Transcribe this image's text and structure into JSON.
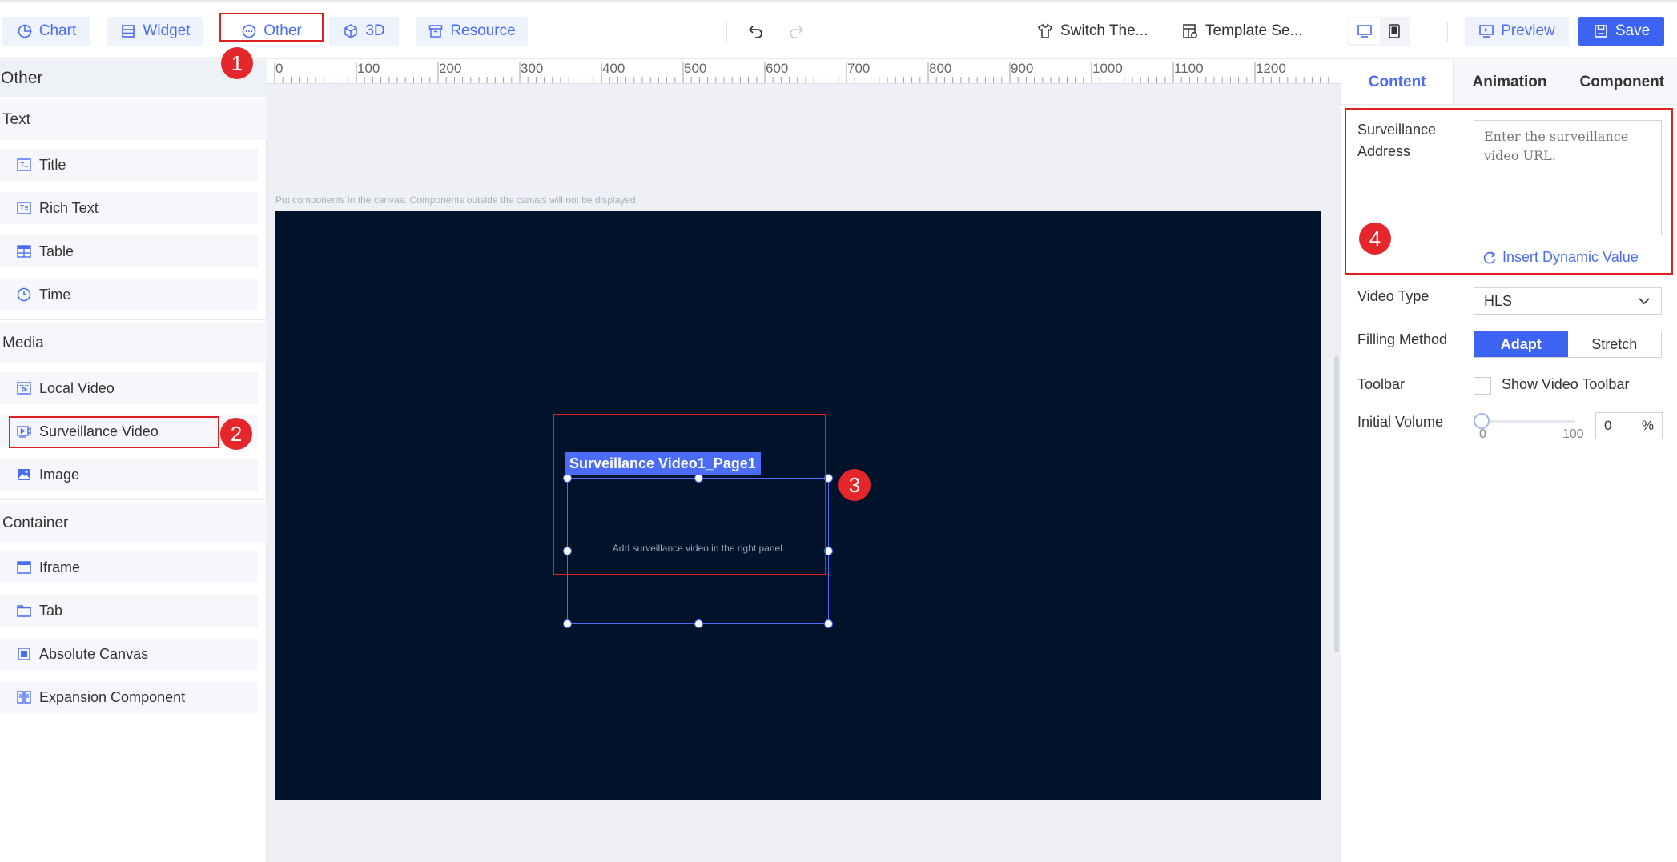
{
  "toolbar": {
    "tabs": [
      {
        "label": "Chart",
        "icon": "chart-pie-icon"
      },
      {
        "label": "Widget",
        "icon": "widget-icon"
      },
      {
        "label": "Other",
        "icon": "other-icon"
      },
      {
        "label": "3D",
        "icon": "cube-icon"
      },
      {
        "label": "Resource",
        "icon": "archive-icon"
      }
    ],
    "undo_icon": "undo-icon",
    "redo_icon": "redo-icon",
    "switch_theme": "Switch The...",
    "template_settings": "Template Se...",
    "preview": "Preview",
    "save": "Save",
    "accent_color": "#4a6cf7"
  },
  "annotations": {
    "one": "1",
    "two": "2",
    "three": "3",
    "four": "4",
    "color": "#e5262a"
  },
  "left_panel": {
    "title": "Other",
    "groups": {
      "text": {
        "label": "Text",
        "items": [
          "Title",
          "Rich Text",
          "Table",
          "Time"
        ]
      },
      "media": {
        "label": "Media",
        "items": [
          "Local Video",
          "Surveillance Video",
          "Image"
        ]
      },
      "container": {
        "label": "Container",
        "items": [
          "Iframe",
          "Tab",
          "Absolute Canvas",
          "Expansion Component"
        ]
      }
    }
  },
  "canvas": {
    "ruler_labels": [
      "0",
      "100",
      "200",
      "300",
      "400",
      "500",
      "600",
      "700",
      "800",
      "900",
      "1000",
      "1100",
      "1200"
    ],
    "hint": "Put components in the canvas. Components outside the canvas will not be displayed.",
    "background": "#00132b",
    "component": {
      "label": "Surveillance Video1_Page1",
      "placeholder": "Add surveillance video in the right panel."
    }
  },
  "right_panel": {
    "tabs": [
      "Content",
      "Animation",
      "Component"
    ],
    "surveillance_address_label": "Surveillance Address",
    "surveillance_address_placeholder": "Enter the surveillance video URL.",
    "insert_dynamic_value": "Insert Dynamic Value",
    "video_type_label": "Video Type",
    "video_type_value": "HLS",
    "filling_method_label": "Filling Method",
    "filling_options": [
      "Adapt",
      "Stretch"
    ],
    "filling_selected": "Adapt",
    "toolbar_label": "Toolbar",
    "show_toolbar_label": "Show Video Toolbar",
    "show_toolbar_checked": false,
    "initial_volume_label": "Initial Volume",
    "volume_min": "0",
    "volume_max": "100",
    "volume_value": "0",
    "volume_unit": "%"
  }
}
